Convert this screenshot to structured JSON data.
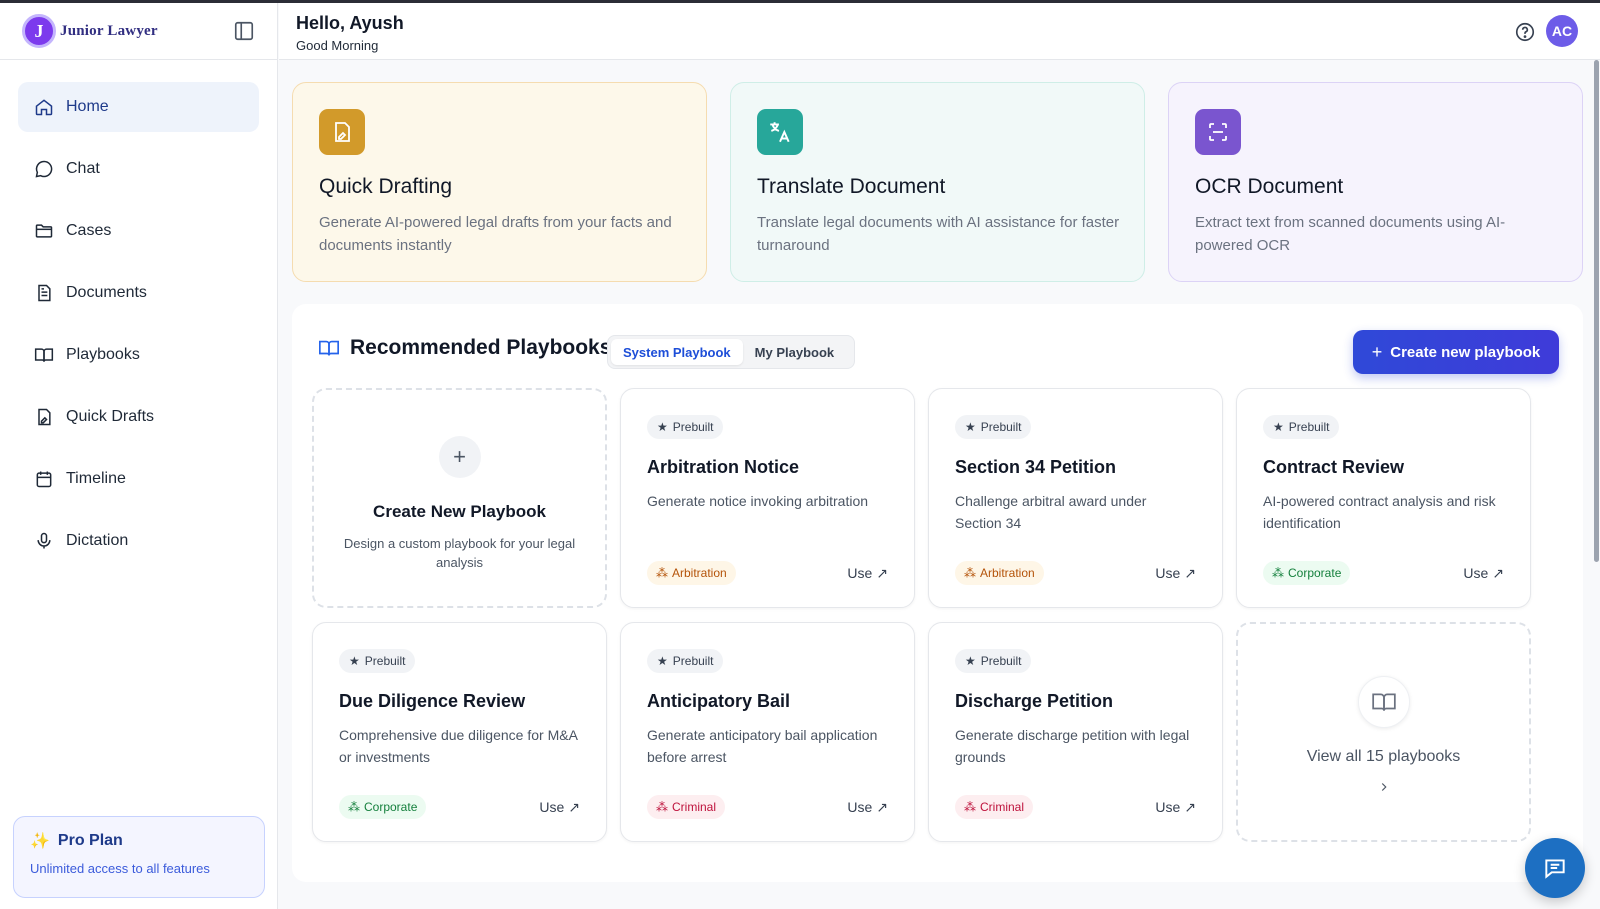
{
  "app": {
    "brand_name": "Junior Lawyer",
    "logo_letter": "J"
  },
  "header": {
    "greeting": "Hello, Ayush",
    "subgreeting": "Good Morning",
    "avatar_initials": "AC"
  },
  "sidebar": {
    "items": [
      {
        "label": "Home",
        "icon": "home-icon",
        "active": true
      },
      {
        "label": "Chat",
        "icon": "chat-icon"
      },
      {
        "label": "Cases",
        "icon": "folder-icon"
      },
      {
        "label": "Documents",
        "icon": "document-icon"
      },
      {
        "label": "Playbooks",
        "icon": "book-icon"
      },
      {
        "label": "Quick Drafts",
        "icon": "draft-icon"
      },
      {
        "label": "Timeline",
        "icon": "calendar-icon"
      },
      {
        "label": "Dictation",
        "icon": "microphone-icon"
      }
    ],
    "pro_plan": {
      "title": "Pro Plan",
      "subtitle": "Unlimited access to all features"
    }
  },
  "features": [
    {
      "title": "Quick Drafting",
      "description": "Generate AI-powered legal drafts from your facts and documents instantly",
      "icon": "draft-icon",
      "color": "#d29a2a"
    },
    {
      "title": "Translate Document",
      "description": "Translate legal documents with AI assistance for faster turnaround",
      "icon": "translate-icon",
      "color": "#27a79a"
    },
    {
      "title": "OCR Document",
      "description": "Extract text from scanned documents using AI-powered OCR",
      "icon": "scan-icon",
      "color": "#7a55cf"
    }
  ],
  "playbooks": {
    "title": "Recommended Playbooks",
    "tabs": [
      {
        "label": "System Playbook",
        "active": true
      },
      {
        "label": "My Playbook"
      }
    ],
    "create_button": "Create new playbook",
    "create_card": {
      "title": "Create New Playbook",
      "description": "Design a custom playbook for your legal analysis"
    },
    "badge_label": "Prebuilt",
    "use_label": "Use",
    "items": [
      {
        "title": "Arbitration Notice",
        "description": "Generate notice invoking arbitration",
        "tag": "Arbitration",
        "tag_type": "arb"
      },
      {
        "title": "Section 34 Petition",
        "description": "Challenge arbitral award under Section 34",
        "tag": "Arbitration",
        "tag_type": "arb"
      },
      {
        "title": "Contract Review",
        "description": "AI-powered contract analysis and risk identification",
        "tag": "Corporate",
        "tag_type": "corp"
      },
      {
        "title": "Due Diligence Review",
        "description": "Comprehensive due diligence for M&A or investments",
        "tag": "Corporate",
        "tag_type": "corp"
      },
      {
        "title": "Anticipatory Bail",
        "description": "Generate anticipatory bail application before arrest",
        "tag": "Criminal",
        "tag_type": "crim"
      },
      {
        "title": "Discharge Petition",
        "description": "Generate discharge petition with legal grounds",
        "tag": "Criminal",
        "tag_type": "crim"
      }
    ],
    "view_all": "View all 15 playbooks"
  }
}
